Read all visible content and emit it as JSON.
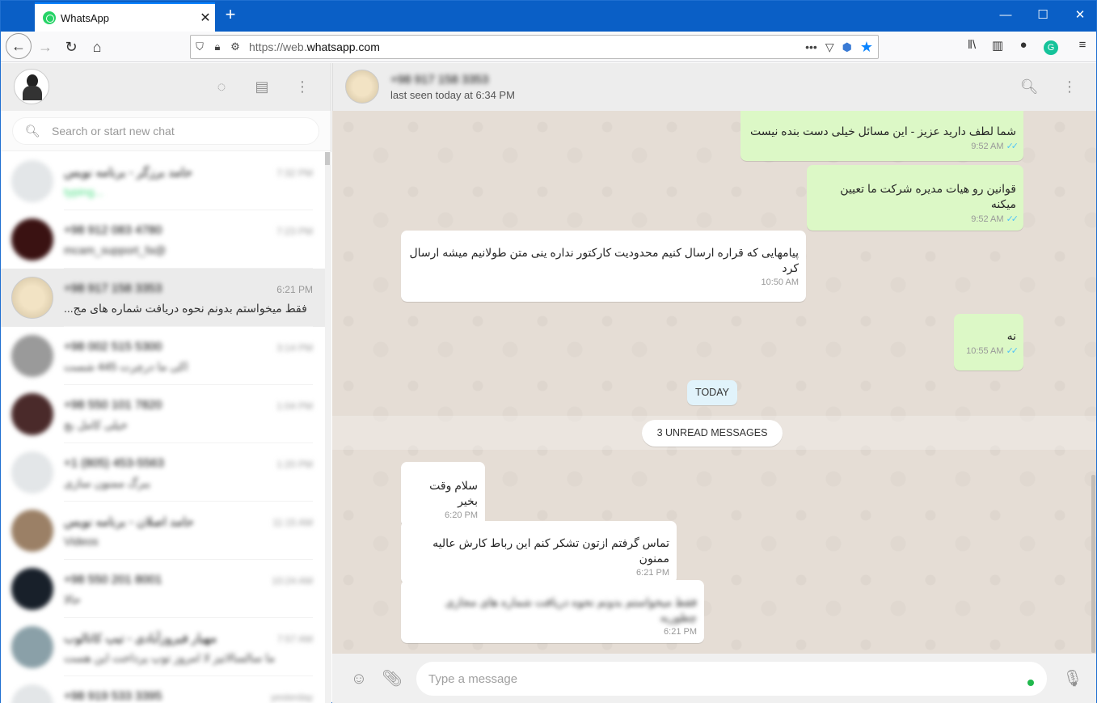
{
  "browser": {
    "tab_title": "WhatsApp",
    "url_prefix": "https://web.",
    "url_domain": "whatsapp.com"
  },
  "sidebar": {
    "search_placeholder": "Search or start new chat",
    "chats": [
      {
        "name": "حامد برزگر - برنامه نویس",
        "time": "7:32 PM",
        "preview": "typing...",
        "blurred": true,
        "avatar_color": "#e3e6e8"
      },
      {
        "name": "+98 912 083 4780",
        "time": "7:23 PM",
        "preview": "@mcam_support_fa",
        "blurred": true,
        "avatar_color": "#3a1212"
      },
      {
        "name": "+98 917 158 3353",
        "time": "6:21 PM",
        "preview": "فقط میخواستم بدونم نحوه دریافت شماره های مج...",
        "blurred": false,
        "active": true,
        "avatar_color": "#d8cfc0"
      },
      {
        "name": "+98 002 515 5300",
        "time": "3:14 PM",
        "preview": "اکی ما درچرت 445 شست",
        "blurred": true,
        "avatar_color": "#9a9a9a"
      },
      {
        "name": "+98 550 101 7820",
        "time": "1:04 PM",
        "preview": "خیلی کامل بچ",
        "blurred": true,
        "avatar_color": "#4a2a2a"
      },
      {
        "name": "+1 (805) 453-5563",
        "time": "1:20 PM",
        "preview": "ببرگ ممنون سازی",
        "blurred": true,
        "avatar_color": "#e3e6e8"
      },
      {
        "name": "حامد اصلان - برنامه نویس",
        "time": "11:15 AM",
        "preview": "Videos",
        "blurred": true,
        "avatar_color": "#9b8066"
      },
      {
        "name": "+98 550 201 8001",
        "time": "10:24 AM",
        "preview": "حالا",
        "blurred": true,
        "avatar_color": "#18202a"
      },
      {
        "name": "مهیار فیروزآبادی - تیپ کاتالوب",
        "time": "7:57 AM",
        "preview": "ما سالسالاتیز لا امروز توپ پرداخت این هست",
        "blurred": true,
        "avatar_color": "#8aa0a8"
      },
      {
        "name": "+98 919 533 3395",
        "time": "yesterday",
        "preview": "",
        "blurred": true,
        "avatar_color": "#e3e6e8"
      }
    ]
  },
  "conversation": {
    "contact_name": "+98 917 158 3353",
    "status": "last seen today at 6:34 PM",
    "messages": [
      {
        "dir": "out",
        "text": "شما لطف دارید عزیز - این مسائل خیلی دست بنده نیست",
        "time": "9:52 AM"
      },
      {
        "dir": "out",
        "text": "قوانین رو هیات مدیره شرکت ما تعیین میکنه",
        "time": "9:52 AM"
      },
      {
        "dir": "in",
        "text": "پیامهایی که قراره ارسال کنیم محدودیت کارکتور نداره ینی متن طولانیم میشه ارسال کرد",
        "time": "10:50 AM"
      },
      {
        "dir": "out",
        "text": "نه",
        "time": "10:55 AM"
      },
      {
        "dir": "in",
        "text": "سلام وقت بخیر",
        "time": "6:20 PM"
      },
      {
        "dir": "in",
        "text": "تماس گرفتم ازتون تشکر کنم این رباط کارش عالیه ممنون",
        "time": "6:21 PM"
      },
      {
        "dir": "in",
        "text": "فقط میخواستم بدونم نحوه دریافت شماره های مجازی چطوریه",
        "time": "6:21 PM",
        "blurred": true
      }
    ],
    "date_chip": "TODAY",
    "unread_label": "3 UNREAD MESSAGES",
    "compose_placeholder": "Type a message"
  },
  "colors": {
    "outgoing_bubble": "#dcf8c6",
    "incoming_bubble": "#ffffff",
    "chat_bg": "#e5ddd5",
    "read_tick": "#4fc3f7"
  }
}
